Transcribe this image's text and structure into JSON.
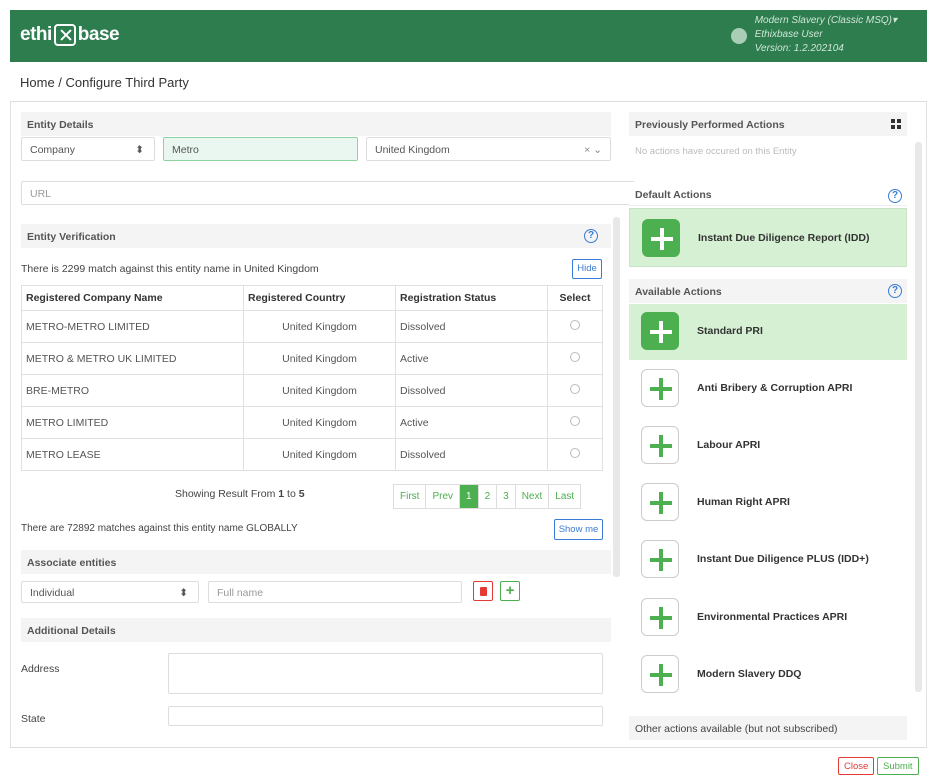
{
  "app": {
    "brand_left": "ethi",
    "brand_right": "base",
    "user_line1": "Modern Slavery (Classic MSQ)▾",
    "user_line2": "Ethixbase User",
    "user_line3": "Version: 1.2.202104"
  },
  "breadcrumb": "Home / Configure Third Party",
  "entity_details": {
    "title": "Entity Details",
    "type": "Company",
    "name": "Metro",
    "country": "United Kingdom",
    "url_placeholder": "URL"
  },
  "verification": {
    "title": "Entity Verification",
    "match_text": "There is 2299 match against this entity name in United Kingdom",
    "hide_label": "Hide",
    "columns": [
      "Registered Company Name",
      "Registered Country",
      "Registration Status",
      "Select"
    ],
    "rows": [
      [
        "METRO-METRO LIMITED",
        "United Kingdom",
        "Dissolved"
      ],
      [
        "METRO & METRO UK LIMITED",
        "United Kingdom",
        "Active"
      ],
      [
        "BRE-METRO",
        "United Kingdom",
        "Dissolved"
      ],
      [
        "METRO LIMITED",
        "United Kingdom",
        "Active"
      ],
      [
        "METRO LEASE",
        "United Kingdom",
        "Dissolved"
      ]
    ],
    "showing_prefix": "Showing Result From ",
    "showing_from": "1",
    "showing_to_word": " to ",
    "showing_to": "5",
    "pager": [
      "First",
      "Prev",
      "1",
      "2",
      "3",
      "Next",
      "Last"
    ],
    "global_text": "There are 72892 matches against this entity name GLOBALLY",
    "show_me": "Show me"
  },
  "associate": {
    "title": "Associate entities",
    "type": "Individual",
    "name_placeholder": "Full name"
  },
  "additional": {
    "title": "Additional Details",
    "address_label": "Address",
    "state_label": "State"
  },
  "right": {
    "prev_title": "Previously Performed Actions",
    "prev_empty": "No actions have occured on this Entity",
    "default_title": "Default Actions",
    "default_action": "Instant Due Diligence Report (IDD)",
    "available_title": "Available Actions",
    "available": [
      "Standard PRI",
      "Anti Bribery & Corruption APRI",
      "Labour APRI",
      "Human Right APRI",
      "Instant Due Diligence PLUS (IDD+)",
      "Environmental Practices APRI",
      "Modern Slavery DDQ"
    ],
    "other_title": "Other actions available (but not subscribed)"
  },
  "footer": {
    "close": "Close",
    "submit": "Submit"
  }
}
